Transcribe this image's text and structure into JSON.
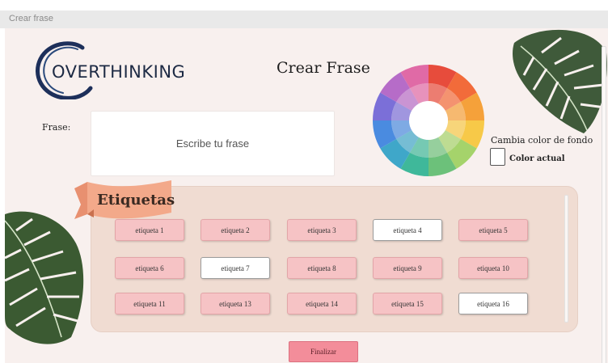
{
  "window": {
    "title": "Crear frase"
  },
  "logo": {
    "text": "OVERTHINKING"
  },
  "page": {
    "title": "Crear Frase"
  },
  "frase": {
    "label": "Frase:",
    "placeholder": "Escribe tu frase"
  },
  "background": {
    "caption": "Cambia color de fondo",
    "current_label": "Color actual",
    "current_color": "#ffffff"
  },
  "tags": {
    "title": "Etiquetas",
    "items": [
      {
        "label": "etiqueta 1",
        "selected": false
      },
      {
        "label": "etiqueta 2",
        "selected": false
      },
      {
        "label": "etiqueta 3",
        "selected": false
      },
      {
        "label": "etiqueta 4",
        "selected": true
      },
      {
        "label": "etiqueta 5",
        "selected": false
      },
      {
        "label": "etiqueta 6",
        "selected": false
      },
      {
        "label": "etiqueta 7",
        "selected": true
      },
      {
        "label": "etiqueta 8",
        "selected": false
      },
      {
        "label": "etiqueta 9",
        "selected": false
      },
      {
        "label": "etiqueta 10",
        "selected": false
      },
      {
        "label": "etiqueta 11",
        "selected": false
      },
      {
        "label": "etiqueta 13",
        "selected": false
      },
      {
        "label": "etiqueta 14",
        "selected": false
      },
      {
        "label": "etiqueta 15",
        "selected": false
      },
      {
        "label": "etiqueta 16",
        "selected": true
      }
    ]
  },
  "actions": {
    "finalize_label": "Finalizar"
  },
  "colors": {
    "tag_unselected": "#f6c3c5",
    "tag_selected": "#ffffff",
    "finalize": "#f38d9a",
    "panel": "#f0dcd2",
    "wheel": [
      "#e74c3c",
      "#f26b3a",
      "#f5a13a",
      "#f7c948",
      "#a5d36b",
      "#6cc17a",
      "#3fb89a",
      "#3fa7c9",
      "#4a8be0",
      "#7b6fd8",
      "#b66cc8",
      "#e06aa6"
    ]
  }
}
